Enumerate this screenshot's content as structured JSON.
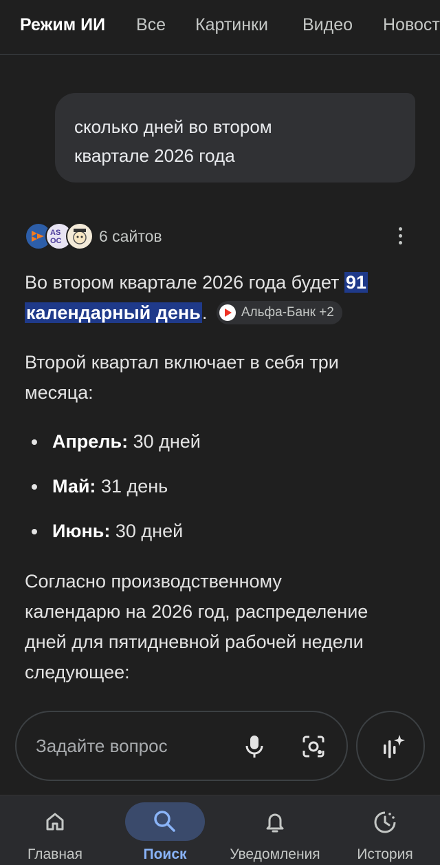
{
  "tabs": [
    "Режим ИИ",
    "Все",
    "Картинки",
    "Видео",
    "Новости"
  ],
  "query": {
    "line1": "сколько дней во втором",
    "line2": "квартале 2026 года"
  },
  "sources": {
    "count_label": "6 сайтов",
    "icons": [
      "site-logo-1",
      "site-logo-2",
      "site-logo-3"
    ]
  },
  "answer": {
    "p1_before": "Во втором квартале 2026 года будет ",
    "p1_highlight_a": "91",
    "p1_highlight_b": "календарный день",
    "p1_after": ".",
    "citation": "Альфа-Банк +2",
    "p2_line1": "Второй квартал включает в себя три",
    "p2_line2": "месяца:",
    "months": [
      {
        "name": "Апрель:",
        "value": " 30 дней"
      },
      {
        "name": "Май:",
        "value": " 31 день"
      },
      {
        "name": "Июнь:",
        "value": " 30 дней"
      }
    ],
    "p3_line1": "Согласно производственному",
    "p3_line2": "календарю на 2026 год, распределение",
    "p3_line3": "дней для пятидневной рабочей недели",
    "p3_line4": "следующее:"
  },
  "ask": {
    "placeholder": "Задайте вопрос"
  },
  "nav": {
    "home": "Главная",
    "search": "Поиск",
    "notifications": "Уведомления",
    "history": "История"
  },
  "colors": {
    "background": "#1f1f1f",
    "highlight": "#1f3a8a",
    "active_nav": "#8ab4f8"
  }
}
